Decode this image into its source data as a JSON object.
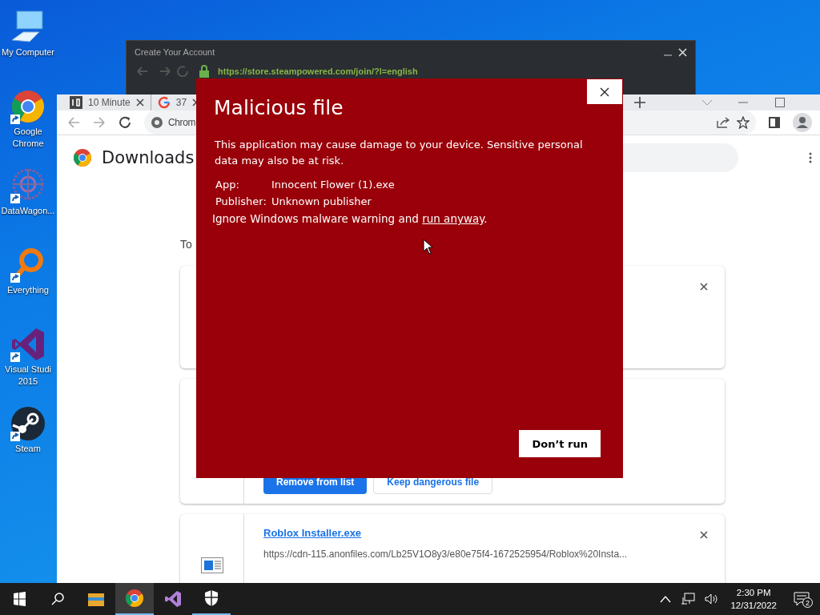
{
  "desktop_icons": [
    {
      "label": "My Computer",
      "kind": "computer"
    },
    {
      "label": "Google Chrome",
      "kind": "chrome"
    },
    {
      "label": "DataWagon...",
      "kind": "datawagon"
    },
    {
      "label": "Everything",
      "kind": "everything"
    },
    {
      "label": "Visual Studi 2015",
      "kind": "vs"
    },
    {
      "label": "Steam",
      "kind": "steam"
    }
  ],
  "steam_window": {
    "title": "Create Your Account",
    "url": "https://store.steampowered.com/join/?l=english"
  },
  "browser": {
    "tabs": [
      {
        "title": "10 Minute"
      },
      {
        "title": "37"
      }
    ],
    "omnibox": "Chrom",
    "page_title": "Downloads",
    "section": "To",
    "downloads": [
      {
        "kind": "blank"
      },
      {
        "kind": "dangerous",
        "buttons": [
          {
            "label": "Remove from list",
            "primary": true
          },
          {
            "label": "Keep dangerous file",
            "primary": false
          }
        ]
      },
      {
        "kind": "file",
        "name": "Roblox Installer.exe",
        "url": "https://cdn-115.anonfiles.com/Lb25V1O8y3/e80e75f4-1672525954/Roblox%20Insta..."
      }
    ]
  },
  "dialog": {
    "title": "Malicious file",
    "message": "This application may cause damage to your device. Sensitive personal data may also be at risk.",
    "details": [
      {
        "label": "App:",
        "value": "Innocent Flower (1).exe"
      },
      {
        "label": "Publisher:",
        "value": "Unknown publisher"
      }
    ],
    "warning": "Ignore Windows malware warning and ",
    "link": "run anyway",
    "warning_end": ".",
    "button": "Don’t run"
  },
  "taskbar": {
    "apps": [
      {
        "kind": "explorer",
        "selected": false,
        "running": false
      },
      {
        "kind": "chrome",
        "selected": true,
        "running": true
      },
      {
        "kind": "vs",
        "selected": false,
        "running": false
      },
      {
        "kind": "security",
        "selected": false,
        "running": true
      }
    ],
    "time": "2:30 PM",
    "date": "12/31/2022",
    "notifications": "2"
  }
}
